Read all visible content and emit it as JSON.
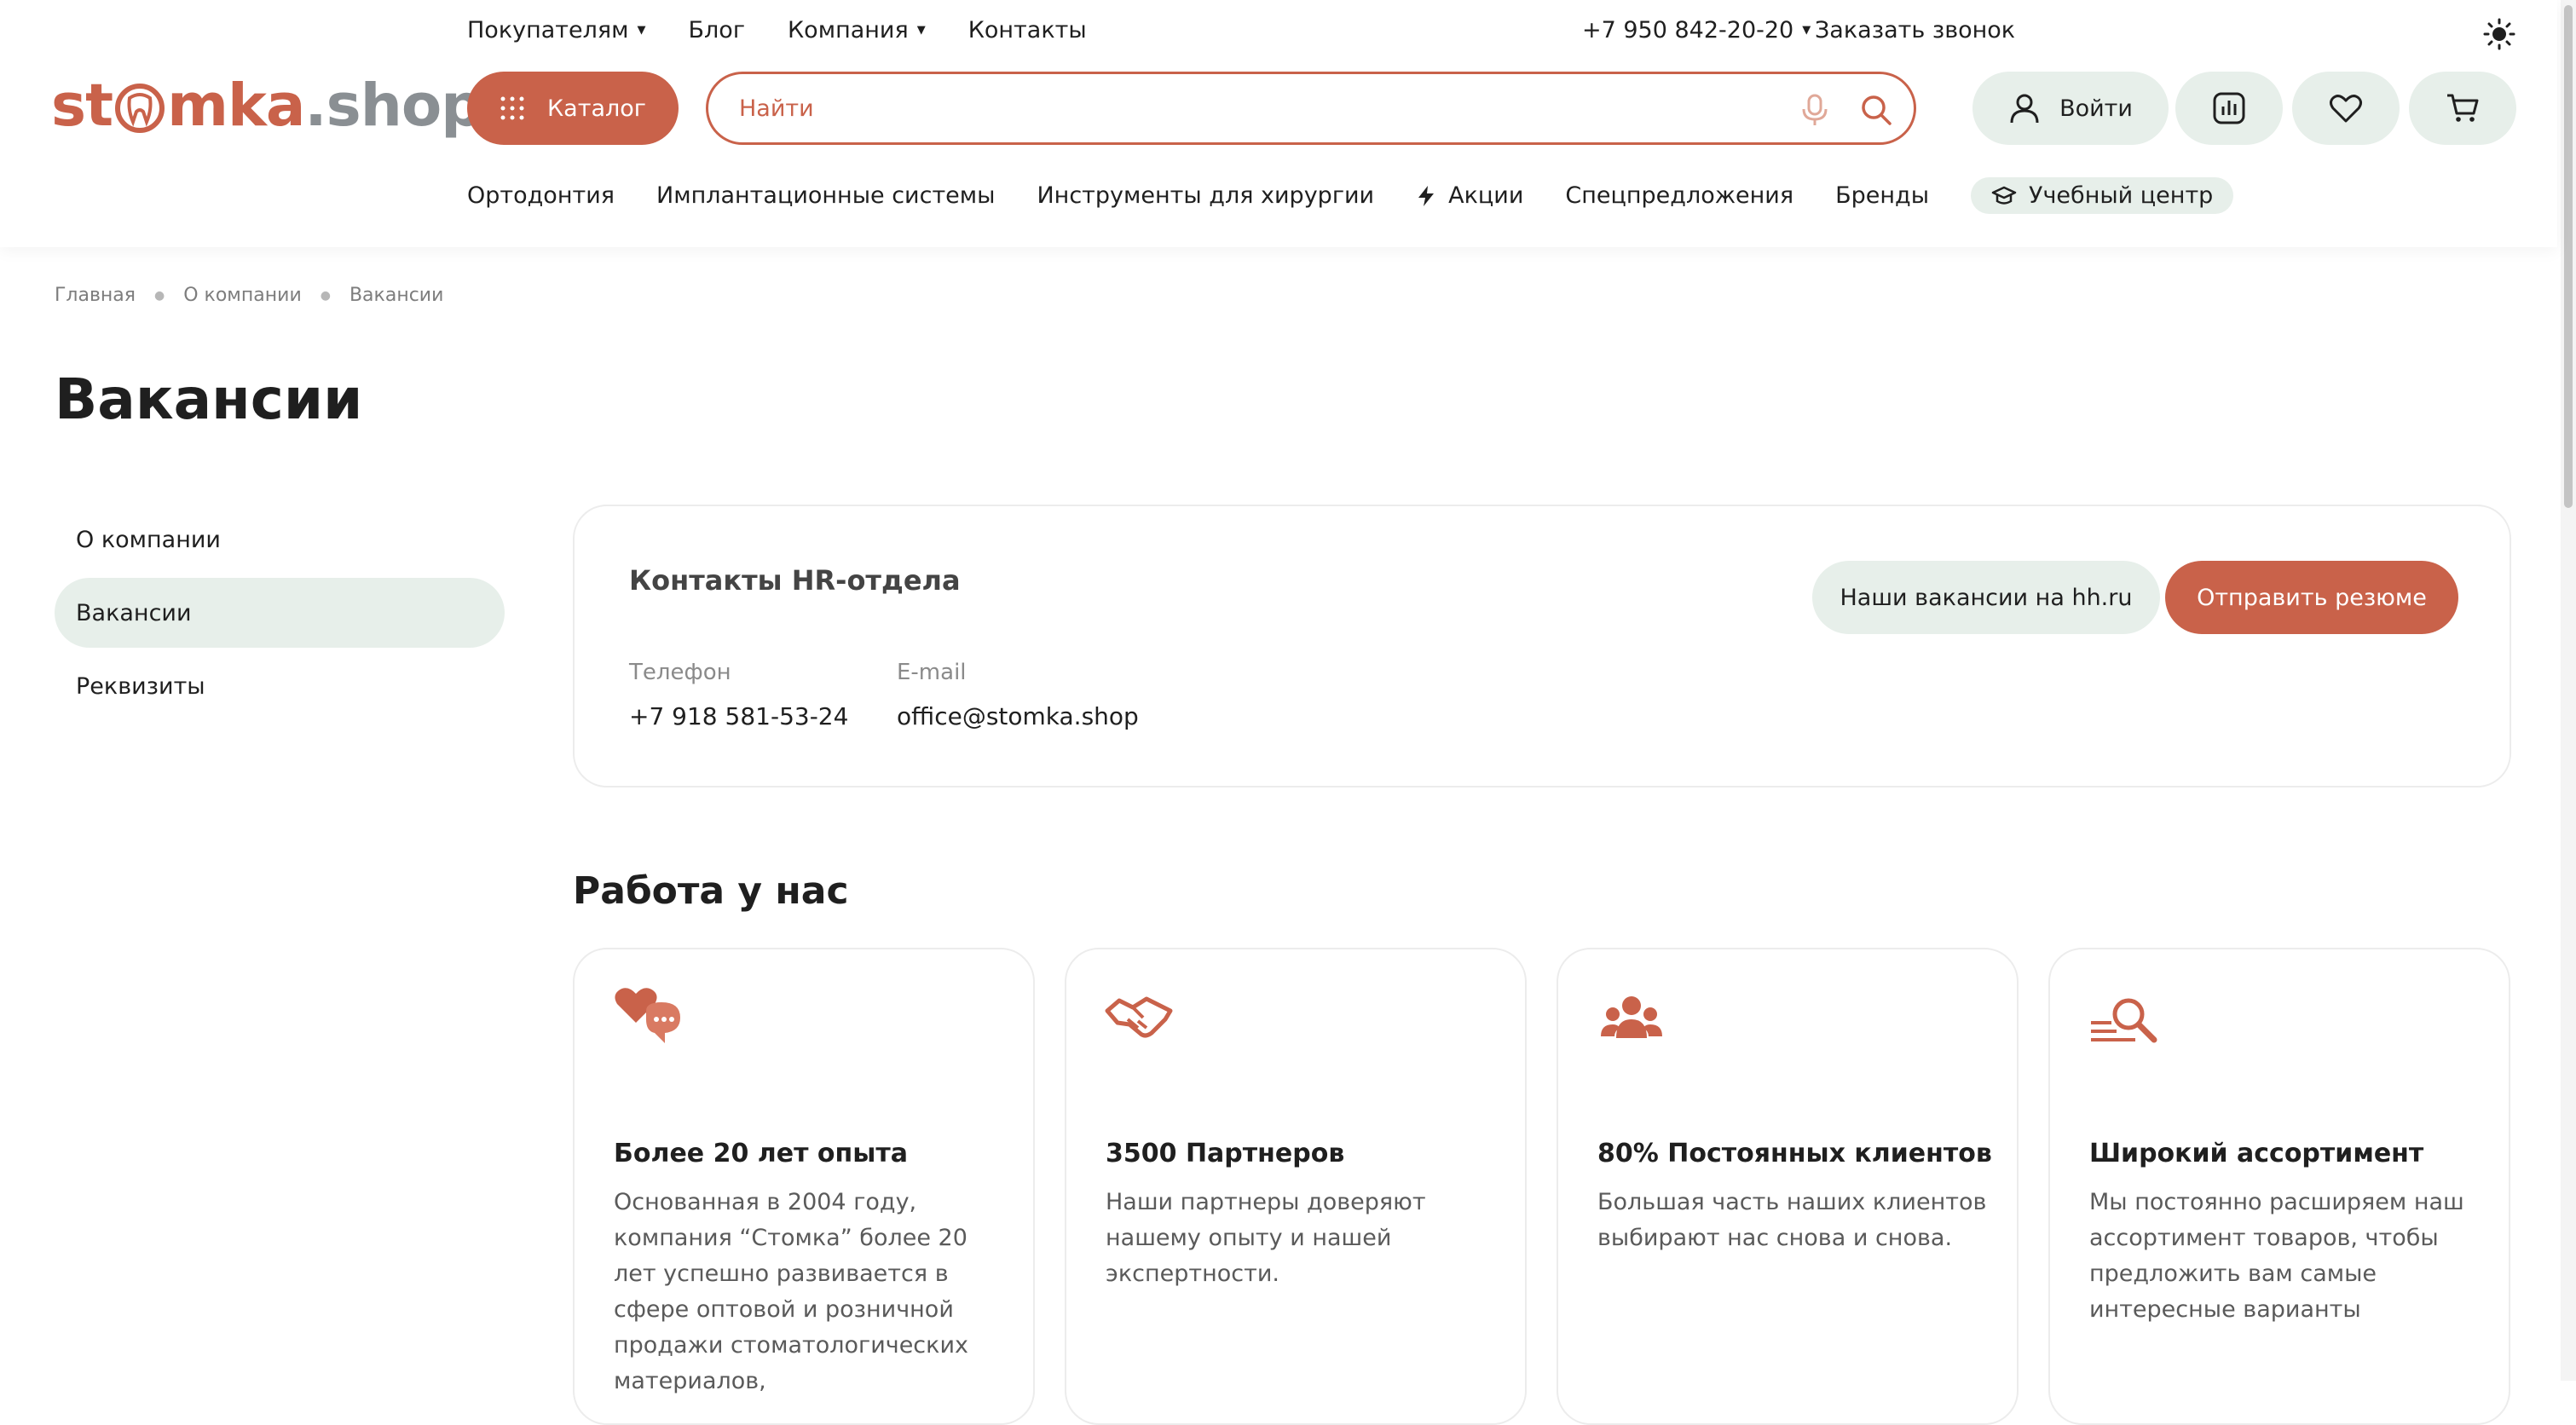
{
  "header": {
    "top_nav": [
      "Покупателям",
      "Блог",
      "Компания",
      "Контакты"
    ],
    "phone": "+7 950 842-20-20",
    "callback": "Заказать звонок",
    "logo_left": "st",
    "logo_middle": "mka",
    "logo_right": ".shop",
    "catalog": "Каталог",
    "search_placeholder": "Найти",
    "login": "Войти",
    "sub_nav": [
      "Ортодонтия",
      "Имплантационные системы",
      "Инструменты для хирургии",
      "Акции",
      "Спецпредложения",
      "Бренды",
      "Учебный центр"
    ]
  },
  "breadcrumb": [
    "Главная",
    "О компании",
    "Вакансии"
  ],
  "page_title": "Вакансии",
  "side_menu": [
    "О компании",
    "Вакансии",
    "Реквизиты"
  ],
  "hr": {
    "title": "Контакты HR-отдела",
    "phone_label": "Телефон",
    "phone": "+7 918 581-53-24",
    "email_label": "E-mail",
    "email": "office@stomka.shop",
    "btn_hh": "Наши вакансии на hh.ru",
    "btn_cv": "Отправить резюме"
  },
  "work": {
    "title": "Работа у нас",
    "cards": [
      {
        "icon": "heart-chat-icon",
        "title": "Более 20 лет опыта",
        "text": "Основанная в 2004 году, компания “Стомка” более 20 лет успешно развивается в сфере оптовой и розничной продажи стоматологических материалов,"
      },
      {
        "icon": "handshake-icon",
        "title": "3500 Партнеров",
        "text": "Наши партнеры доверяют нашему опыту и нашей экспертности."
      },
      {
        "icon": "people-icon",
        "title": "80% Постоянных клиентов",
        "text": "Большая часть наших клиентов выбирают нас снова и снова."
      },
      {
        "icon": "search-list-icon",
        "title": "Широкий ассортимент",
        "text": "Мы постоянно расширяем наш ассортимент товаров, чтобы предложить вам самые интересные варианты"
      }
    ]
  },
  "colors": {
    "accent": "#c9624a",
    "pill": "#e7efea"
  }
}
